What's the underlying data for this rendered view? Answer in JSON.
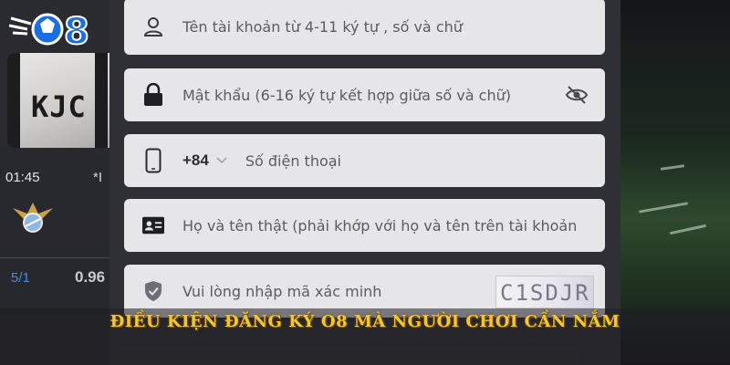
{
  "brand": {
    "logo_text": "O8",
    "primary_color": "#1a6fe0"
  },
  "form": {
    "username": {
      "placeholder": "Tên tài khoản từ 4-11 ký tự , số và chữ",
      "icon": "user-icon"
    },
    "password": {
      "placeholder": "Mật khẩu (6-16 ký tự kết hợp giữa số và chữ)",
      "icon": "lock-icon",
      "toggle_icon": "eye-slash-icon"
    },
    "phone": {
      "country_code": "+84",
      "placeholder": "Số điện thoại",
      "icon": "phone-icon"
    },
    "real_name": {
      "placeholder": "Họ và tên thật (phải khớp với họ và tên trên tài khoản",
      "icon": "id-card-icon"
    },
    "captcha": {
      "placeholder": "Vui lòng nhập mã xác minh",
      "code": "C1SDJR",
      "icon": "shield-check-icon"
    }
  },
  "background": {
    "jersey_text": "KJC",
    "match_time": "01:45",
    "match_extra": "*I",
    "odds_fraction": "5/1",
    "odds_value": "0.96"
  },
  "caption": "ĐIỀU KIỆN ĐĂNG KÝ O8 MÀ NGƯỜI CHƠI CẦN NẮM",
  "colors": {
    "caption": "#f4c534",
    "panel": "#2f3035",
    "field": "#e6e6e9"
  }
}
